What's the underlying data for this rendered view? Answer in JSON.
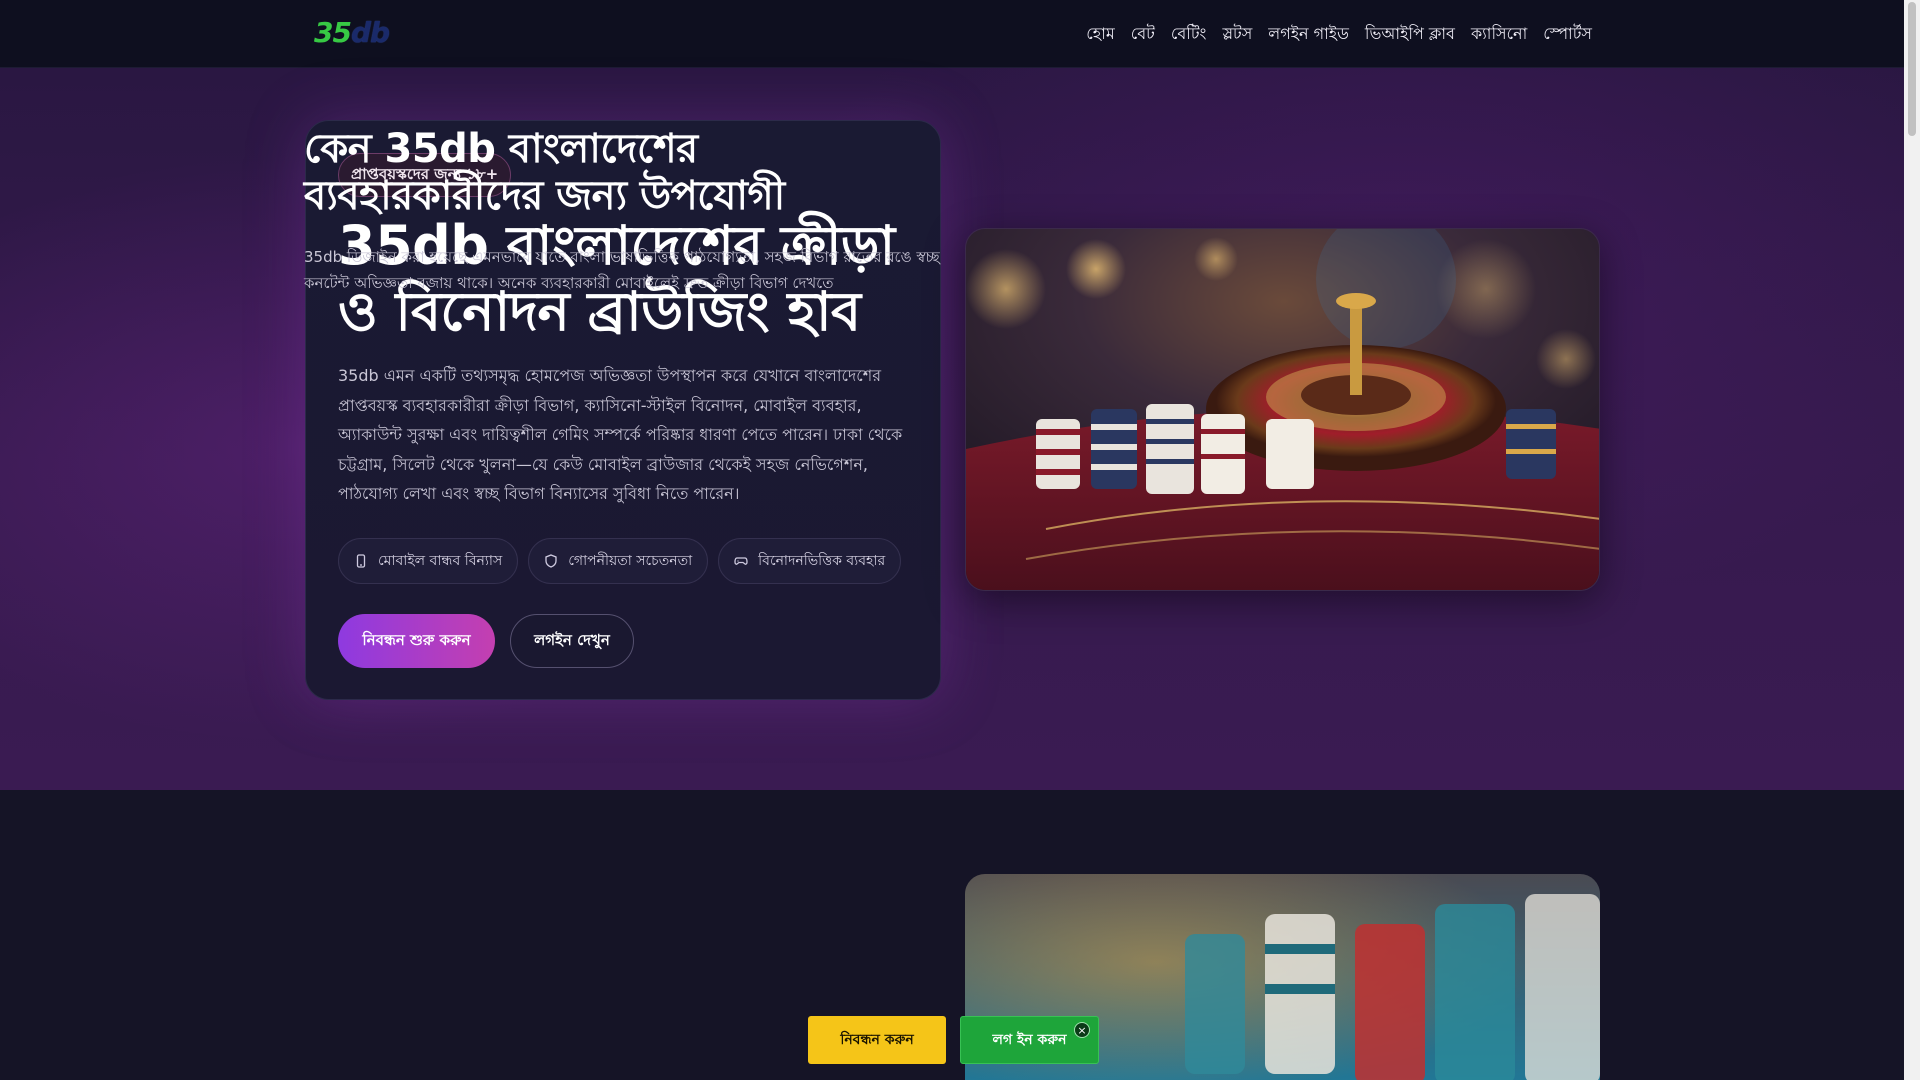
{
  "header": {
    "logo": {
      "part1": "35",
      "part2": "db"
    },
    "nav": [
      "হোম",
      "বেট",
      "বেটিং",
      "স্লটস",
      "লগইন গাইড",
      "ভিআইপি ক্লাব",
      "ক্যাসিনো",
      "স্পোর্টস"
    ]
  },
  "hero": {
    "badge": "প্রাপ্তবয়স্কদের জন্য ১৮+",
    "title": "35db বাংলাদেশের ক্রীড়া ও বিনোদন ব্রাউজিং হাব",
    "description": "35db এমন একটি তথ্যসমৃদ্ধ হোমপেজ অভিজ্ঞতা উপস্থাপন করে যেখানে বাংলাদেশের প্রাপ্তবয়স্ক ব্যবহারকারীরা ক্রীড়া বিভাগ, ক্যাসিনো-স্টাইল বিনোদন, মোবাইল ব্যবহার, অ্যাকাউন্ট সুরক্ষা এবং দায়িত্বশীল গেমিং সম্পর্কে পরিষ্কার ধারণা পেতে পারেন। ঢাকা থেকে চট্টগ্রাম, সিলেট থেকে খুলনা—যে কেউ মোবাইল ব্রাউজার থেকেই সহজ নেভিগেশন, পাঠযোগ্য লেখা এবং স্বচ্ছ বিভাগ বিন্যাসের সুবিধা নিতে পারেন।",
    "chips": [
      {
        "icon": "phone-icon",
        "label": "মোবাইল বান্ধব বিন্যাস"
      },
      {
        "icon": "shield-icon",
        "label": "গোপনীয়তা সচেতনতা"
      },
      {
        "icon": "gamepad-icon",
        "label": "বিনোদনভিত্তিক ব্যবহার"
      }
    ],
    "primary_button": "নিবন্ধন শুরু করুন",
    "secondary_button": "লগইন দেখুন"
  },
  "section2": {
    "title": "কেন 35db বাংলাদেশের ব্যবহারকারীদের জন্য উপযোগী",
    "description": "35db ডিজাইন করা হয়েছে এমনভাবে যাতে বাংলা ভাষাভিত্তিক পাঠযোগ্যতা, সহজ বিভাগ রাতের রঙে স্বচ্ছ কনটেন্ট অভিজ্ঞতা বজায় থাকে। অনেক ব্যবহারকারী মোবাইলেই দ্রুত ক্রীড়া বিভাগ দেখতে"
  },
  "floating": {
    "register": "নিবন্ধন করুন",
    "login": "লগ ইন করুন",
    "close": "×"
  },
  "colors": {
    "accent_gradient_start": "#8e3ae0",
    "accent_gradient_end": "#c43fb0",
    "register_yellow": "#f5c518",
    "login_green": "#1ea53a",
    "logo_green": "#37c944"
  }
}
